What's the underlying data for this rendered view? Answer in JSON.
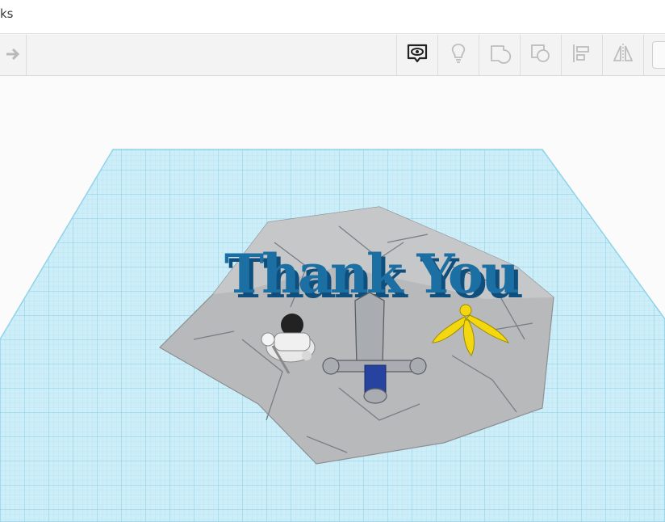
{
  "window": {
    "title_fragment": "ks"
  },
  "toolbar": {
    "icons": [
      "redo-icon",
      "notes-eye-icon",
      "lightbulb-icon",
      "group-icon",
      "ungroup-icon",
      "align-icon",
      "mirror-icon"
    ]
  },
  "scene": {
    "text_3d": "Thank You",
    "colors": {
      "workplane": "#cdeef8",
      "grid_line": "#7fcbe3",
      "rock": "#b8b9bb",
      "text": "#1b6fa3",
      "sword_grip": "#2743a0",
      "flower": "#f4d80f",
      "knight": "#e8e8e8"
    }
  }
}
